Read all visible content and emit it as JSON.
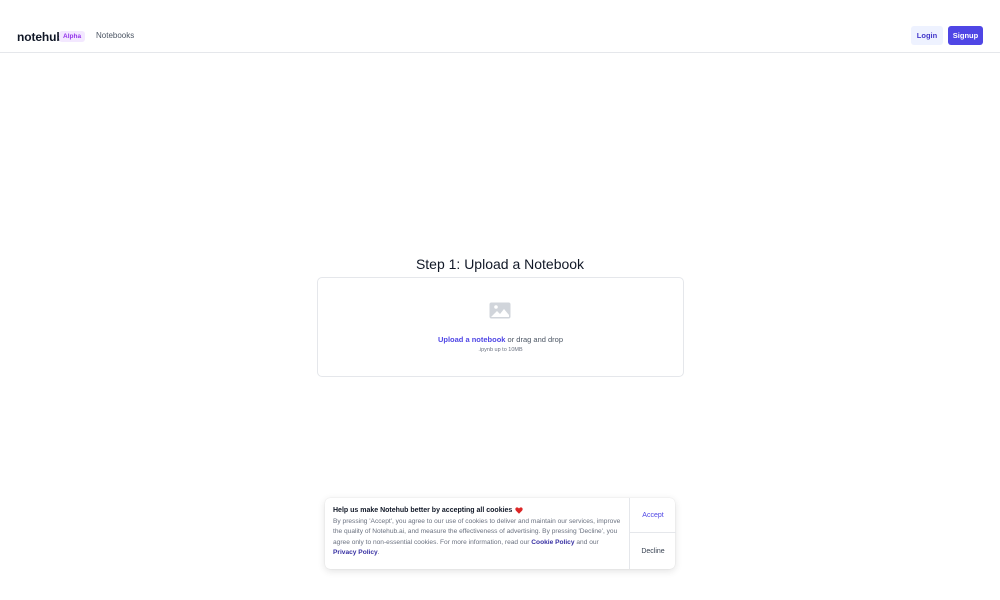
{
  "header": {
    "logo": "notehub.ai",
    "badge": "Alpha",
    "nav": {
      "notebooks": "Notebooks"
    },
    "login_label": "Login",
    "signup_label": "Signup"
  },
  "main": {
    "title": "Step 1: Upload a Notebook",
    "upload_link": "Upload a notebook",
    "upload_suffix": " or drag and drop",
    "hint": ".ipynb up to 10MB",
    "icon": "image-icon"
  },
  "cookie": {
    "title": "Help us make Notehub better by accepting all cookies",
    "title_icon": "heart-icon",
    "text_before": "By pressing 'Accept', you agree to our use of cookies to deliver and maintain our services, improve the quality of Notehub.ai, and measure the effectiveness of advertising. By pressing 'Decline', you agree only to non-essential cookies. For more information, read our ",
    "cookie_policy": "Cookie Policy",
    "text_middle": " and our ",
    "privacy_policy": "Privacy Policy",
    "text_end": ".",
    "accept_label": "Accept",
    "decline_label": "Decline"
  },
  "colors": {
    "accent": "#4f46e5",
    "badge_text": "#9333ea",
    "badge_bg": "#f3e8ff",
    "heart": "#dc2626"
  }
}
